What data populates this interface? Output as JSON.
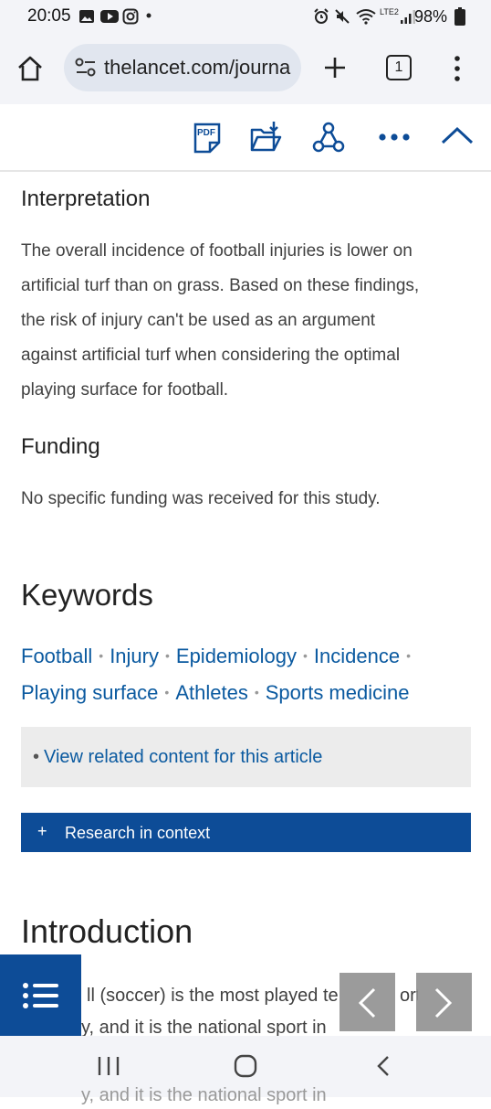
{
  "status_bar": {
    "time": "20:05",
    "battery": "98%",
    "network": "LTE2"
  },
  "browser": {
    "url": "thelancet.com/journa",
    "tab_count": "1"
  },
  "toolbar": {
    "pdf_label": "PDF"
  },
  "interpretation": {
    "heading": "Interpretation",
    "lines": [
      "The overall incidence of football injuries is lower on",
      "artificial turf than on grass. Based on these findings,",
      "the risk of injury can't be used as an argument",
      "against artificial turf when considering the optimal",
      "playing surface for football."
    ]
  },
  "funding": {
    "heading": "Funding",
    "text": "No specific funding was received for this study."
  },
  "keywords": {
    "heading": "Keywords",
    "items": [
      "Football",
      "Injury",
      "Epidemiology",
      "Incidence",
      "Playing surface",
      "Athletes",
      "Sports medicine"
    ],
    "separator": "•"
  },
  "related": {
    "bullet": "•",
    "link": "View related content for this article"
  },
  "research": {
    "icon": "+",
    "label": "Research in context"
  },
  "introduction": {
    "heading": "Introduction",
    "lines": [
      "ll (soccer) is the most played te",
      "ort",
      "y, and it is the national sport in"
    ],
    "under_nav": "y, and it is the national sport in"
  },
  "colors": {
    "link": "#0b5aa0",
    "brand": "#0d4c97"
  }
}
